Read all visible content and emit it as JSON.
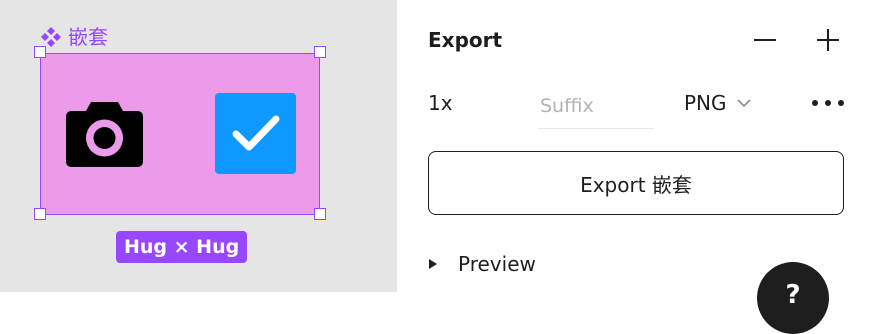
{
  "canvas": {
    "component": {
      "icon": "component-diamond-icon",
      "name": "嵌套",
      "label_color": "#9747ff",
      "fill_color": "#ee9aeb",
      "children": [
        {
          "icon": "camera-icon",
          "color": "#000000"
        },
        {
          "icon": "checkbox-checked-icon",
          "color": "#0d99ff"
        }
      ]
    },
    "sizing_badge": "Hug × Hug"
  },
  "export_panel": {
    "title": "Export",
    "remove_icon": "minus-icon",
    "add_icon": "plus-icon",
    "setting": {
      "scale": "1x",
      "suffix_value": "",
      "suffix_placeholder": "Suffix",
      "format": "PNG",
      "format_icon": "chevron-down-icon",
      "more_icon": "more-horizontal-icon"
    },
    "export_button_label": "Export 嵌套",
    "preview": {
      "icon": "caret-right-icon",
      "label": "Preview"
    },
    "help_icon": "help-icon",
    "help_glyph": "?"
  }
}
